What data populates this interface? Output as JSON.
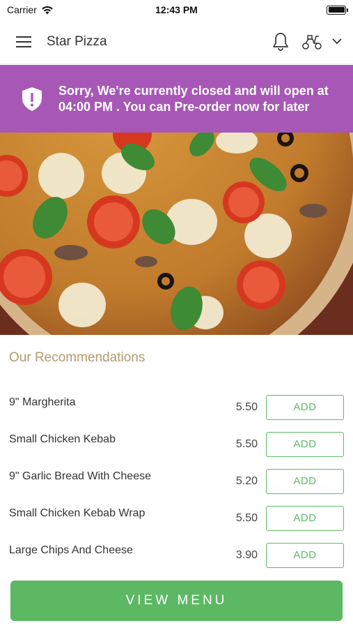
{
  "status_bar": {
    "carrier": "Carrier",
    "time": "12:43 PM"
  },
  "header": {
    "title": "Star Pizza"
  },
  "closed_banner": {
    "message": "Sorry, We're currently closed and will open at 04:00 PM . You can Pre-order now for later",
    "color": "#a757b6"
  },
  "recommendations": {
    "title": "Our Recommendations",
    "items": [
      {
        "name": "9\" Margherita",
        "price": "5.50",
        "button": "ADD"
      },
      {
        "name": "Small Chicken Kebab",
        "price": "5.50",
        "button": "ADD"
      },
      {
        "name": "9\" Garlic Bread With Cheese",
        "price": "5.20",
        "button": "ADD"
      },
      {
        "name": "Small Chicken Kebab Wrap",
        "price": "5.50",
        "button": "ADD"
      },
      {
        "name": "Large Chips And Cheese",
        "price": "3.90",
        "button": "ADD"
      }
    ]
  },
  "view_menu_label": "VIEW MENU",
  "colors": {
    "accent_green": "#5cb863",
    "banner_purple": "#a757b6",
    "section_title": "#b59a6d"
  }
}
